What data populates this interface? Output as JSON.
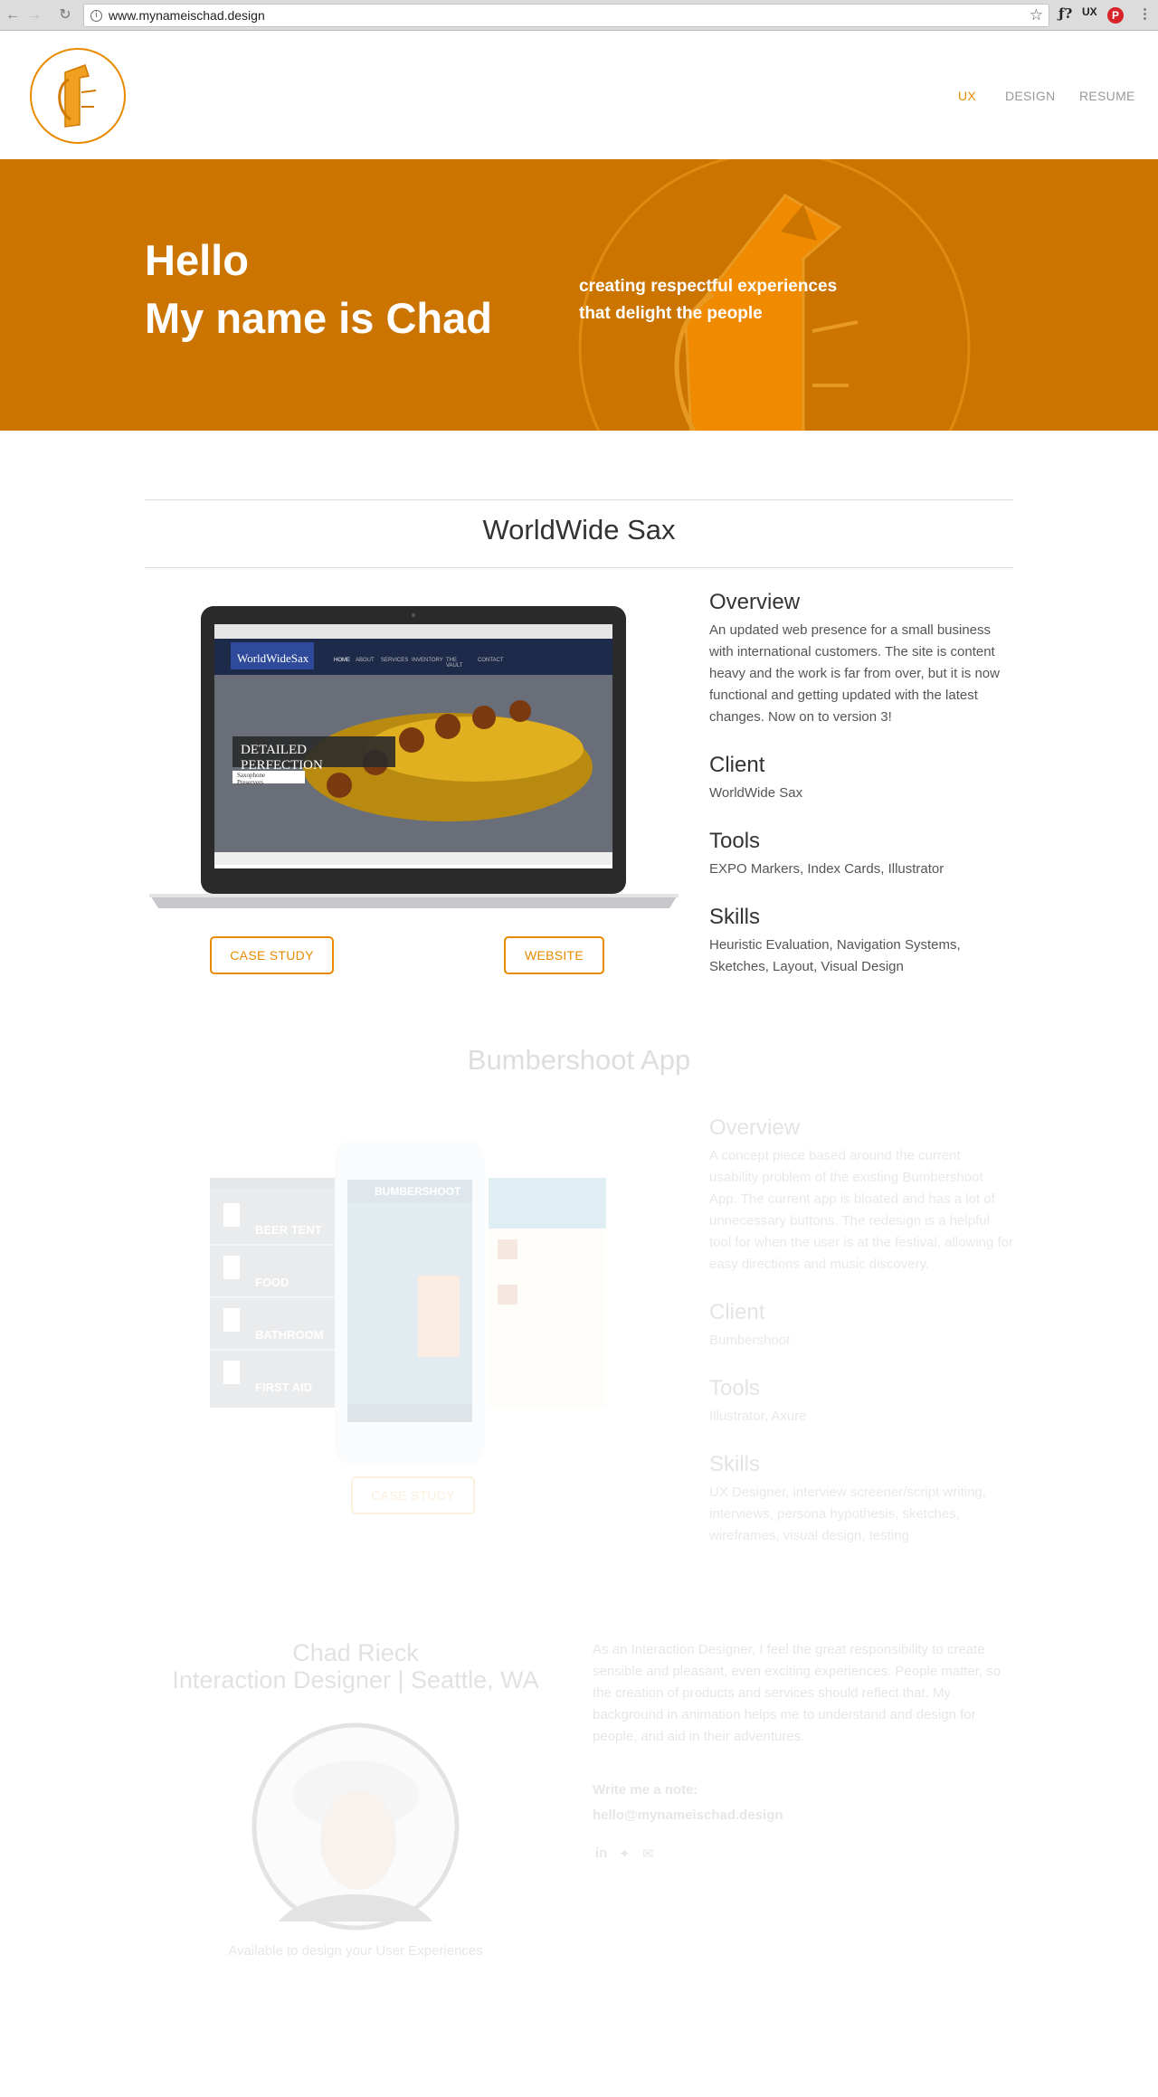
{
  "browser": {
    "url": "www.mynameischad.design",
    "extensions": [
      "ƒ?",
      "UX",
      "P"
    ]
  },
  "nav": {
    "items": [
      {
        "label": "UX",
        "active": true
      },
      {
        "label": "DESIGN",
        "active": false
      },
      {
        "label": "RESUME",
        "active": false
      }
    ]
  },
  "hero": {
    "line1": "Hello",
    "line2": "My name is Chad",
    "tagline1": "creating respectful experiences",
    "tagline2": "that delight the people"
  },
  "project1": {
    "title": "WorldWide Sax",
    "overview_heading": "Overview",
    "overview_text": "An updated web presence for a small business with international customers.  The site is content heavy and the work is far from over, but it is now functional and getting updated with the latest changes.  Now on to version 3!",
    "client_heading": "Client",
    "client_text": "WorldWide Sax",
    "tools_heading": "Tools",
    "tools_text": "EXPO Markers, Index Cards, Illustrator",
    "skills_heading": "Skills",
    "skills_text": "Heuristic Evaluation, Navigation Systems, Sketches, Layout, Visual Design",
    "case_study_label": "CASE STUDY",
    "website_label": "WEBSITE",
    "screen": {
      "brand": "WorldWideSax",
      "banner": "DETAILED PERFECTION",
      "sub": "Saxophone Preservers",
      "menu": [
        "HOME",
        "ABOUT",
        "SERVICES",
        "INVENTORY",
        "THE VAULT",
        "CONTACT"
      ]
    }
  },
  "project2": {
    "title": "Bumbershoot App",
    "overview_heading": "Overview",
    "overview_text": "A concept piece based around the current usability problem of the existing Bumbershoot App.  The current app is bloated and has a lot of unnecessary buttons.  The redesign is a helpful tool for when the user is at the festival, allowing for easy directions and music discovery.",
    "client_heading": "Client",
    "client_text": "Bumbershoot",
    "tools_heading": "Tools",
    "tools_text": "Illustrator, Axure",
    "skills_heading": "Skills",
    "skills_text": "UX Designer, interview screener/script writing, interviews, persona hypothesis, sketches, wireframes, visual design, testing",
    "case_study_label": "CASE STUDY",
    "app_menu": [
      "BEER TENT",
      "FOOD",
      "BATHROOM",
      "FIRST AID"
    ],
    "app_brand": "BUMBERSHOOT"
  },
  "about": {
    "name": "Chad Rieck",
    "role": "Interaction Designer | Seattle, WA",
    "available": "Available to design your User Experiences",
    "bio": "As an Interaction Designer, I feel the great responsibility to create sensible and pleasant, even exciting experiences. People matter, so the creation of products and services should reflect that.  My background in animation helps me to understand and design for people, and aid in their adventures.",
    "note_label": "Write me a note:",
    "email": "hello@mynameischad.design"
  },
  "colors": {
    "accent": "#e88a00",
    "hero_bg": "#cc7400"
  }
}
